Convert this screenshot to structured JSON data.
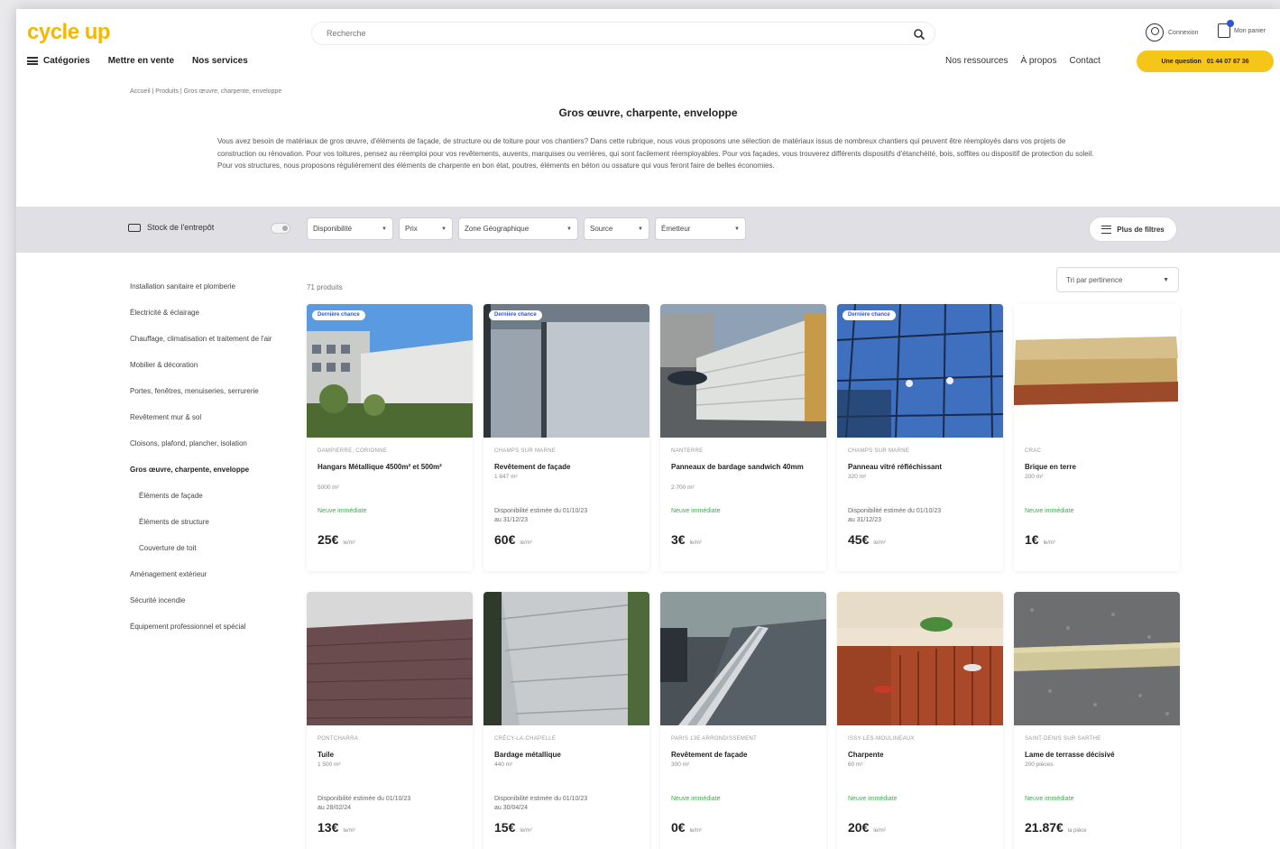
{
  "header": {
    "logo": "cycle up",
    "search_placeholder": "Recherche",
    "account_label": "Connexion",
    "cart_label": "Mon panier",
    "nav_left": {
      "categories": "Catégories",
      "sell": "Mettre en vente",
      "services": "Nos services"
    },
    "nav_right": {
      "resources": "Nos ressources",
      "about": "À propos",
      "contact": "Contact"
    },
    "cta": {
      "label": "Une question",
      "phone": "01 44 07 67 36"
    }
  },
  "breadcrumb": "Accueil  |  Produits  |  Gros œuvre, charpente, enveloppe",
  "page_title": "Gros œuvre, charpente, enveloppe",
  "intro": "Vous avez besoin de matériaux de gros œuvre, d'éléments de façade, de structure ou de toiture pour vos chantiers? Dans cette rubrique, nous vous proposons une sélection de matériaux issus de nombreux chantiers qui peuvent être réemployés dans vos projets de construction ou rénovation. Pour vos toitures, pensez au réemploi pour vos revêtements, auvents, marquises ou verrières, qui sont facilement réemployables. Pour vos façades, vous trouverez différents dispositifs d'étanchéité, bois, soffites ou dispositif de protection du soleil. Pour vos structures, nous proposons régulièrement des éléments de charpente en bon état, poutres, éléments en béton ou ossature qui vous feront faire de belles économies.",
  "filters": {
    "stock_label": "Stock de l'entrepôt",
    "dropdowns": [
      "Disponibilité",
      "Prix",
      "Zone Géographique",
      "Source",
      "Émetteur"
    ],
    "more_label": "Plus de filtres",
    "sort_label": "Tri par pertinence"
  },
  "product_count": "71 produits",
  "sidebar": [
    {
      "label": "Installation sanitaire et plomberie",
      "level": 0,
      "active": false
    },
    {
      "label": "Électricité & éclairage",
      "level": 0,
      "active": false
    },
    {
      "label": "Chauffage, climatisation et traitement de l'air",
      "level": 0,
      "active": false
    },
    {
      "label": "Mobilier & décoration",
      "level": 0,
      "active": false
    },
    {
      "label": "Portes, fenêtres, menuiseries, serrurerie",
      "level": 0,
      "active": false
    },
    {
      "label": "Revêtement mur & sol",
      "level": 0,
      "active": false
    },
    {
      "label": "Cloisons, plafond, plancher, isolation",
      "level": 0,
      "active": false
    },
    {
      "label": "Gros œuvre, charpente, enveloppe",
      "level": 0,
      "active": true
    },
    {
      "label": "Éléments de façade",
      "level": 1,
      "active": false
    },
    {
      "label": "Éléments de structure",
      "level": 1,
      "active": false
    },
    {
      "label": "Couverture de toit",
      "level": 1,
      "active": false
    },
    {
      "label": "Aménagement extérieur",
      "level": 0,
      "active": false
    },
    {
      "label": "Sécurité incendie",
      "level": 0,
      "active": false
    },
    {
      "label": "Équipement professionnel et spécial",
      "level": 0,
      "active": false
    }
  ],
  "products": [
    {
      "badge": "Dernière chance",
      "location": "DAMPIERRE, CORIONNE",
      "name": "Hangars Métallique 4500m² et 500m²",
      "qty": "5000 m²",
      "avail": "Neuve immédiate",
      "avail_green": true,
      "price": "25€",
      "unit": "le/m²"
    },
    {
      "badge": "Dernière chance",
      "location": "CHAMPS SUR MARNE",
      "name": "Revêtement de façade",
      "qty": "1 847 m²",
      "avail": "Disponibilité estimée du 01/10/23 au 31/12/23",
      "avail_green": false,
      "price": "60€",
      "unit": "le/m²"
    },
    {
      "badge": "",
      "location": "NANTERRE",
      "name": "Panneaux de bardage sandwich 40mm",
      "qty": "2 700 m²",
      "avail": "Neuve immédiate",
      "avail_green": true,
      "price": "3€",
      "unit": "le/m²"
    },
    {
      "badge": "Dernière chance",
      "location": "CHAMPS SUR MARNE",
      "name": "Panneau vitré réfléchissant",
      "qty": "320 m²",
      "avail": "Disponibilité estimée du 01/10/23 au 31/12/23",
      "avail_green": false,
      "price": "45€",
      "unit": "le/m²"
    },
    {
      "badge": "",
      "location": "CRAC",
      "name": "Brique en terre",
      "qty": "200 m²",
      "avail": "Neuve immédiate",
      "avail_green": true,
      "price": "1€",
      "unit": "le/m²"
    },
    {
      "badge": "",
      "location": "PONTCHARRA",
      "name": "Tuile",
      "qty": "1 500 m²",
      "avail": "Disponibilité estimée du 01/10/23 au 28/02/24",
      "avail_green": false,
      "price": "13€",
      "unit": "le/m²"
    },
    {
      "badge": "",
      "location": "CRÉCY-LA-CHAPELLE",
      "name": "Bardage métallique",
      "qty": "440 m²",
      "avail": "Disponibilité estimée du 01/10/23 au 30/04/24",
      "avail_green": false,
      "price": "15€",
      "unit": "le/m²"
    },
    {
      "badge": "",
      "location": "PARIS 13E ARRONDISSEMENT",
      "name": "Revêtement de façade",
      "qty": "300 m²",
      "avail": "Neuve immédiate",
      "avail_green": true,
      "price": "0€",
      "unit": "le/m²"
    },
    {
      "badge": "",
      "location": "ISSY-LES-MOULINEAUX",
      "name": "Charpente",
      "qty": "60 m²",
      "avail": "Neuve immédiate",
      "avail_green": true,
      "price": "20€",
      "unit": "le/m²"
    },
    {
      "badge": "",
      "location": "SAINT-DENIS SUR SARTHE",
      "name": "Lame de terrasse décisivé",
      "qty": "200 pièces",
      "avail": "Neuve immédiate",
      "avail_green": true,
      "price": "21.87€",
      "unit": "la pièce"
    }
  ]
}
